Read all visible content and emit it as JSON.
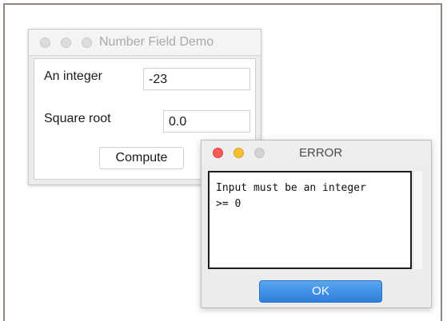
{
  "main_window": {
    "title": "Number Field Demo",
    "fields": [
      {
        "label": "An integer",
        "value": "-23"
      },
      {
        "label": "Square root",
        "value": "0.0"
      }
    ],
    "compute_label": "Compute"
  },
  "error_dialog": {
    "title": "ERROR",
    "message_lines": [
      "Input must be an integer",
      ">= 0"
    ],
    "ok_label": "OK",
    "accent_color": "#3f8ee6"
  }
}
